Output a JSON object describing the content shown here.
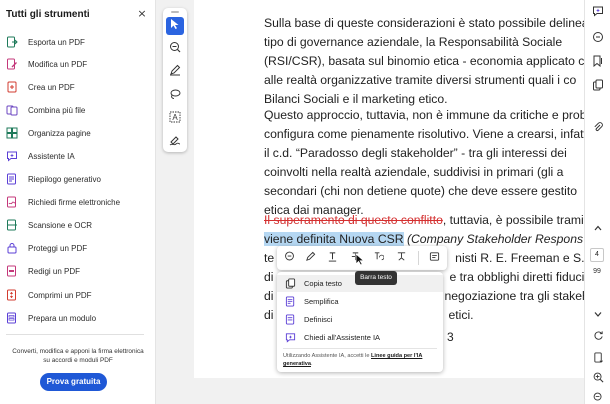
{
  "sidebar": {
    "title": "Tutti gli strumenti",
    "close_glyph": "×",
    "items": [
      {
        "label": "Esporta un PDF",
        "icon": "export-pdf-icon"
      },
      {
        "label": "Modifica un PDF",
        "icon": "edit-pdf-icon"
      },
      {
        "label": "Crea un PDF",
        "icon": "create-pdf-icon"
      },
      {
        "label": "Combina più file",
        "icon": "combine-files-icon"
      },
      {
        "label": "Organizza pagine",
        "icon": "organize-pages-icon"
      },
      {
        "label": "Assistente IA",
        "icon": "ai-assistant-icon"
      },
      {
        "label": "Riepilogo generativo",
        "icon": "generative-summary-icon"
      },
      {
        "label": "Richiedi firme elettroniche",
        "icon": "request-esign-icon"
      },
      {
        "label": "Scansione e OCR",
        "icon": "scan-ocr-icon"
      },
      {
        "label": "Proteggi un PDF",
        "icon": "protect-pdf-icon"
      },
      {
        "label": "Redigi un PDF",
        "icon": "redact-pdf-icon"
      },
      {
        "label": "Comprimi un PDF",
        "icon": "compress-pdf-icon"
      },
      {
        "label": "Prepara un modulo",
        "icon": "prepare-form-icon"
      }
    ],
    "promo_line1": "Converti, modifica e apponi la firma elettronica",
    "promo_line2": "su accordi e moduli PDF",
    "trial_button": "Prova gratuita"
  },
  "document": {
    "p1": [
      "Sulla base di queste considerazioni è stato possibile delineare",
      "tipo di governance aziendale, la Responsabilità Sociale",
      "(RSI/CSR), basata sul binomio etica - economia applicato con",
      "alle realtà organizzative tramite diversi strumenti quali i co",
      "Bilanci Sociali e il marketing etico."
    ],
    "p2": [
      "Questo approccio, tuttavia, non è immune da critiche e probler",
      "configura come pienamente risolutivo. Viene a crearsi, infatti, u",
      "il c.d. “Paradosso degli stakeholder” - tra gli interessi dei",
      "coinvolti nella realtà aziendale, suddivisi in primari (gli a",
      "secondari (chi non detiene quote) che deve essere gestito",
      "etica dai manager."
    ],
    "p3_line1_struck": "Il superamento di questo conflitto",
    "p3_line1_rest": ", tuttavia, è possibile tramite",
    "p3_line2_highlight": "viene definita Nuova CSR",
    "p3_line2_rest": " (Company Stakeholder Respons",
    "p3_line3_start": "te",
    "p3_line3_end": "nisti R. E. Freeman e S. R",
    "p3_line4_start": "di",
    "p3_line4_end": "e tra obblighi diretti fiduciar",
    "p3_line5_start": "di",
    "p3_line5_end": "negoziazione tra gli stakeh",
    "p3_line6_start": "di",
    "p3_line6_end": "etici.",
    "page_number_fragment": "3"
  },
  "context_toolbar": {
    "tooltip": "Barra testo",
    "buttons": [
      "comment-icon",
      "highlight-pen-icon",
      "underline-text-icon",
      "strikethrough-text-icon",
      "replace-text-icon",
      "insert-text-icon",
      "more-options-icon"
    ]
  },
  "context_menu": {
    "items": [
      {
        "label": "Copia testo",
        "icon": "copy-text-icon"
      },
      {
        "label": "Semplifica",
        "icon": "simplify-icon"
      },
      {
        "label": "Definisci",
        "icon": "define-icon"
      },
      {
        "label": "Chiedi all'Assistente IA",
        "icon": "ask-ai-assistant-icon"
      }
    ],
    "note_prefix": "Utilizzando Assistente IA, accetti le ",
    "note_link": "Linee guida per l'IA generativa",
    "note_suffix": "."
  },
  "right_rail": {
    "current_page": "4",
    "page_count": "99"
  },
  "colors": {
    "accent": "#2b64e0",
    "trial_button": "#1f58d6",
    "highlight": "#b5d7f2",
    "strike": "#d43030"
  }
}
